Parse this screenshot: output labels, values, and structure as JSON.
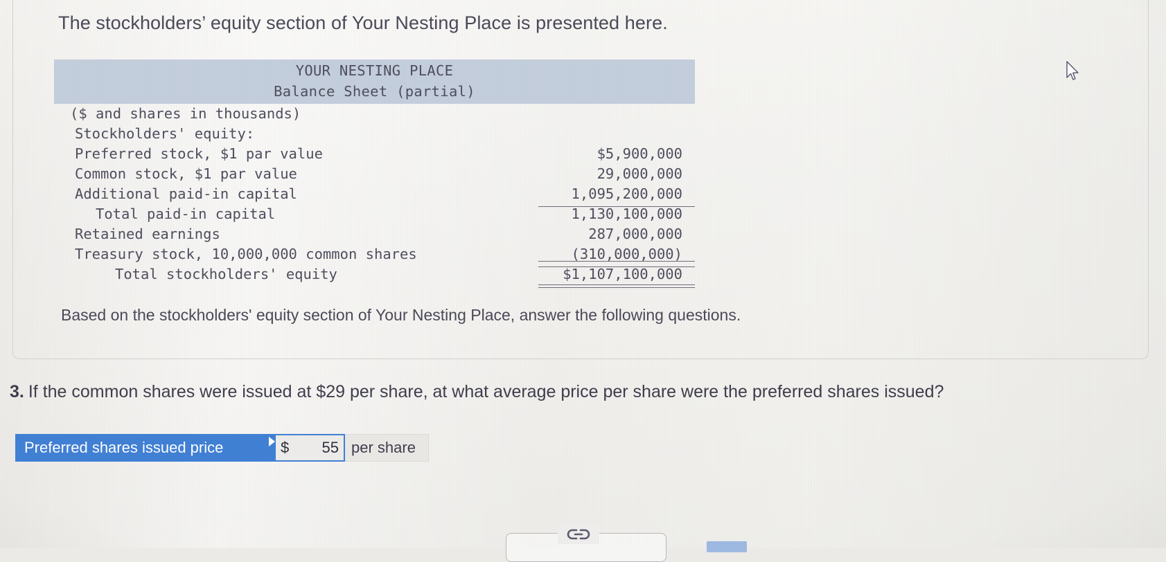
{
  "intro": {
    "heading": "The stockholders’ equity section of Your Nesting Place is presented here."
  },
  "balance_sheet": {
    "company_name": "YOUR NESTING PLACE",
    "statement_title": "Balance Sheet (partial)",
    "units_note": "($ and shares in thousands)",
    "section_heading": "Stockholders' equity:",
    "rows": [
      {
        "label": "Preferred stock, $1 par value",
        "amount": "$5,900,000",
        "indent": 1,
        "rule": "none"
      },
      {
        "label": "Common stock, $1 par value",
        "amount": "29,000,000",
        "indent": 1,
        "rule": "none"
      },
      {
        "label": "Additional paid-in capital",
        "amount": "1,095,200,000",
        "indent": 1,
        "rule": "under"
      },
      {
        "label": "Total paid-in capital",
        "amount": "1,130,100,000",
        "indent": 2,
        "rule": "none"
      },
      {
        "label": "Retained earnings",
        "amount": "287,000,000",
        "indent": 1,
        "rule": "none"
      },
      {
        "label": "Treasury stock, 10,000,000 common shares",
        "amount": "(310,000,000)",
        "indent": 1,
        "rule": "under"
      },
      {
        "label": "Total stockholders' equity",
        "amount": "$1,107,100,000",
        "indent": 3,
        "rule": "double"
      }
    ]
  },
  "instruction": {
    "text": "Based on the stockholders' equity section of Your Nesting Place, answer the following questions."
  },
  "question": {
    "number": "3.",
    "text": "If the common shares were issued at $29 per share, at what average price per share were the preferred shares issued?"
  },
  "answer": {
    "label": "Preferred shares issued price",
    "currency_symbol": "$",
    "value": "55",
    "suffix": "per share"
  },
  "colors": {
    "header_band": "#c3cedc",
    "answer_label_bg": "#3f7fd4",
    "text": "#4a4856"
  },
  "icons": {
    "cursor": "mouse-pointer-icon",
    "link": "⚭"
  }
}
